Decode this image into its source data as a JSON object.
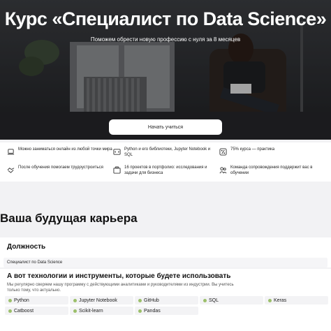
{
  "hero": {
    "title": "Курс «Специалист по Data Science»",
    "subtitle": "Поможем обрести новую профессию с нуля за 8 месяцев",
    "cta_label": "Начать учиться"
  },
  "features": [
    {
      "icon": "laptop-icon",
      "text": "Можно заниматься онлайн из любой точки мира"
    },
    {
      "icon": "code-icon",
      "text": "Python и его библиотеки, Jupyter Notebook и SQL"
    },
    {
      "icon": "percent-icon",
      "text": "75% курса — практика"
    },
    {
      "icon": "handshake-icon",
      "text": "После обучения помогаем трудоустроиться"
    },
    {
      "icon": "portfolio-icon",
      "text": "16 проектов в портфолио: исследования и задачи для бизнеса"
    },
    {
      "icon": "team-icon",
      "text": "Команда сопровождения поддержит вас в обучении"
    }
  ],
  "career": {
    "title": "Ваша будущая карьера",
    "role_heading": "Должность",
    "role_value": "Специалист по Data Science",
    "tech_heading": "А вот технологии и инструменты, которые будете использовать",
    "tech_desc": "Мы регулярно сверяем нашу программу с действующими аналитиками и руководителями из индустрии. Вы учитесь только тому, что актуально.",
    "tags": [
      "Python",
      "Jupyter Notebook",
      "GitHub",
      "SQL",
      "Keras",
      "Catboost",
      "Scikit-learn",
      "Pandas"
    ],
    "tag_dot_color": "#9bbf6a"
  }
}
